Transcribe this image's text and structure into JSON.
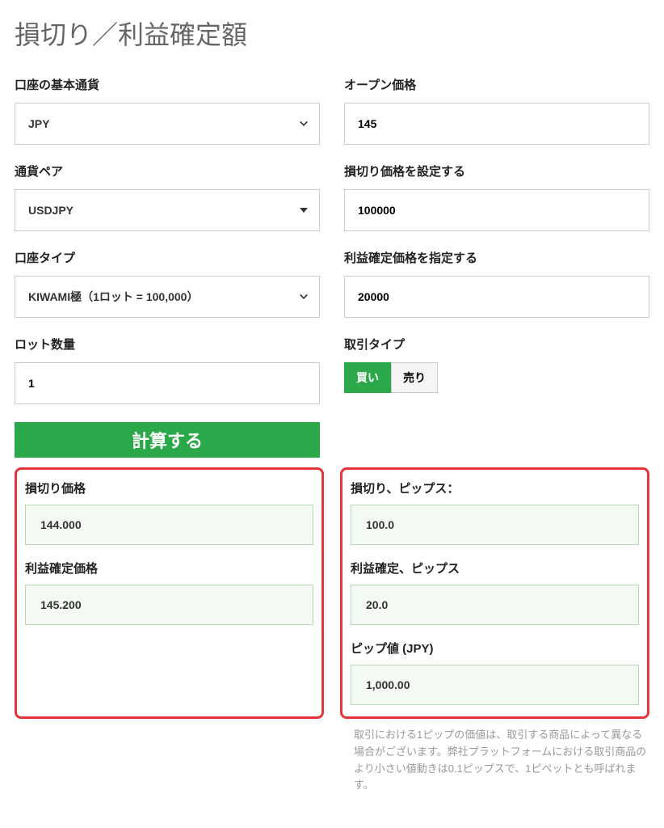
{
  "title": "損切り／利益確定額",
  "form": {
    "left": {
      "base_currency_label": "口座の基本通貨",
      "base_currency_value": "JPY",
      "pair_label": "通貨ペア",
      "pair_value": "USDJPY",
      "account_type_label": "口座タイプ",
      "account_type_value": "KIWAMI極（1ロット = 100,000）",
      "lot_label": "ロット数量",
      "lot_value": "1"
    },
    "right": {
      "open_price_label": "オープン価格",
      "open_price_value": "145",
      "stop_loss_label": "損切り価格を設定する",
      "stop_loss_value": "100000",
      "take_profit_label": "利益確定価格を指定する",
      "take_profit_value": "20000",
      "trade_type_label": "取引タイプ",
      "buy_label": "買い",
      "sell_label": "売り"
    }
  },
  "calc_button": "計算する",
  "results": {
    "left": {
      "sl_price_label": "損切り価格",
      "sl_price_value": "144.000",
      "tp_price_label": "利益確定価格",
      "tp_price_value": "145.200"
    },
    "right": {
      "sl_pips_label": "損切り、ピップス：",
      "sl_pips_value": "100.0",
      "tp_pips_label": "利益確定、ピップス",
      "tp_pips_value": "20.0",
      "pip_value_label": "ピップ値 (JPY)",
      "pip_value_value": "1,000.00"
    }
  },
  "footnote": "取引における1ピップの価値は、取引する商品によって異なる場合がございます。弊社プラットフォームにおける取引商品のより小さい値動きは0.1ピップスで、1ピペットとも呼ばれます。"
}
